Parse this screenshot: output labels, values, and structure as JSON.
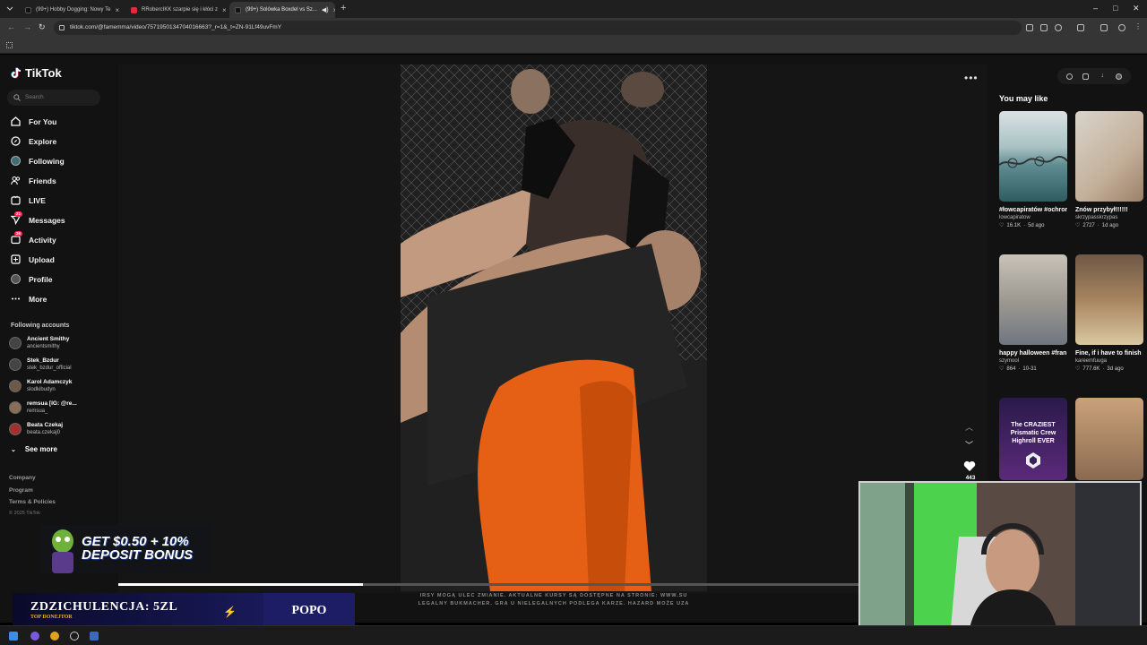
{
  "browser": {
    "tabs": [
      {
        "title": "(99+) Hobby Dogging: Nowy Te",
        "active": false
      },
      {
        "title": "RRobercIKK szarpie się i kłóci z",
        "active": false
      },
      {
        "title": "(99+) Solówka Boxdel vs Sz...",
        "active": true
      }
    ],
    "url": "tiktok.com/@famemma/video/7571950134704016663?_r=1&_t=ZN-91Lf49uvFmY"
  },
  "sidebar": {
    "logo": "TikTok",
    "search_placeholder": "Search",
    "nav": [
      {
        "label": "For You",
        "icon": "home-icon"
      },
      {
        "label": "Explore",
        "icon": "compass-icon"
      },
      {
        "label": "Following",
        "icon": "following-avatar-icon"
      },
      {
        "label": "Friends",
        "icon": "friends-icon"
      },
      {
        "label": "LIVE",
        "icon": "live-icon"
      },
      {
        "label": "Messages",
        "icon": "messages-icon",
        "badge": "21"
      },
      {
        "label": "Activity",
        "icon": "activity-icon",
        "badge": "26"
      },
      {
        "label": "Upload",
        "icon": "upload-icon"
      },
      {
        "label": "Profile",
        "icon": "profile-icon"
      },
      {
        "label": "More",
        "icon": "more-icon"
      }
    ],
    "following_title": "Following accounts",
    "accounts": [
      {
        "name": "Ancient Smithy",
        "handle": "ancientsmithy"
      },
      {
        "name": "Stek_Bzdur",
        "handle": "stek_bzdur_official"
      },
      {
        "name": "Karol Adamczyk",
        "handle": "slodkibudyn"
      },
      {
        "name": "remsua [IG: @re...",
        "handle": "remsua_"
      },
      {
        "name": "Beata Czekaj",
        "handle": "beata.czekaj0"
      }
    ],
    "see_more": "See more",
    "footer": [
      "Company",
      "Program",
      "Terms & Policies"
    ],
    "copyright": "© 2025 TikTok"
  },
  "video": {
    "like_count": "443",
    "progress": 0.33,
    "ticker_line1": "IRSY MOGĄ ULEC ZMIANIE. AKTUALNE KURSY SĄ DOSTĘPNE NA STRONIE: WWW.SU",
    "ticker_line2": "LEGALNY BUKMACHER. GRA U NIELEGALNYCH PODLEGA KARZE. HAZARD MOŻE UZA"
  },
  "recommend": {
    "title": "You may like",
    "cards": [
      {
        "caption": "#łowcapiratów #ochronastatku...",
        "author": "lowcapiratow",
        "likes": "16.1K",
        "date": "5d ago",
        "tone": "#7fa4a8"
      },
      {
        "caption": "Znów przybył!!!!!!",
        "author": "skrzypasskrzypas",
        "likes": "2727",
        "date": "1d ago",
        "tone": "#c9b8a6"
      },
      {
        "caption": "happy halloween #frankenstein...",
        "author": "szymool",
        "likes": "864",
        "date": "10-31",
        "tone": "#b7b0a4"
      },
      {
        "caption": "Fine, if i have to finish it babe #fyp...",
        "author": "kareemfuuga",
        "likes": "777.6K",
        "date": "3d ago",
        "tone": "#8b6e52"
      },
      {
        "caption": "The CRAZIEST Prismatic Crew Highroll EVER",
        "author": "",
        "likes": "",
        "date": "",
        "tone": "#3a1f5a"
      },
      {
        "caption": "",
        "author": "",
        "likes": "",
        "date": "",
        "tone": "#8a6a50"
      }
    ]
  },
  "overlays": {
    "promo_line1": "GET $0.50 + 10%",
    "promo_line2": "DEPOSIT BONUS",
    "donor_title": "ZDZICHULENCJA: 5ZL",
    "donor_sub": "TOP DONEJTOR",
    "donor_name": "POPO"
  }
}
